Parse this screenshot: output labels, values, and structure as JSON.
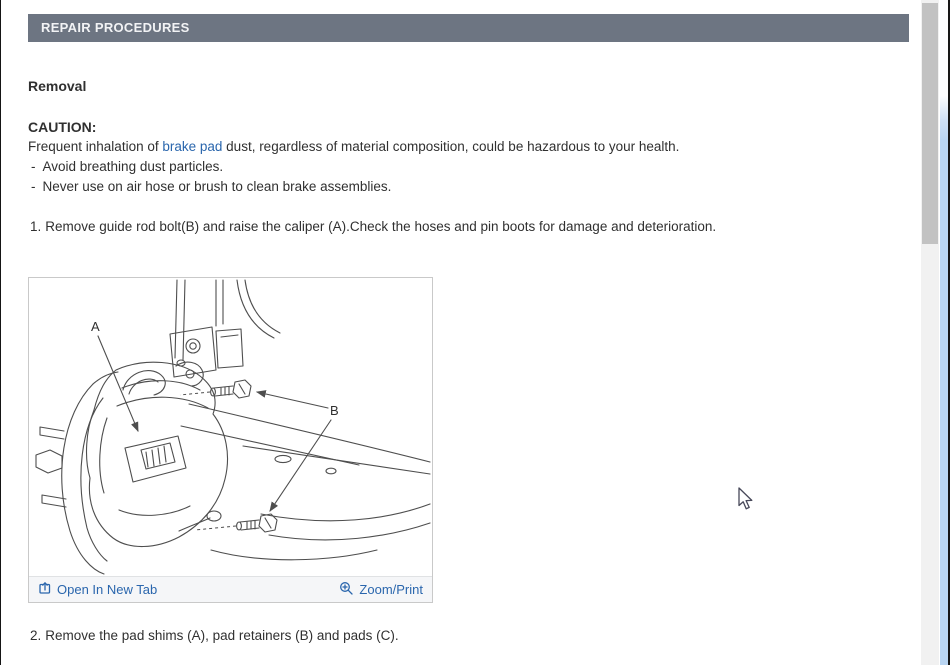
{
  "colors": {
    "header-bg": "#6d7582",
    "header-text": "#f2f3f5",
    "body-text": "#303030",
    "link": "#2a66ad",
    "figure-border": "#c9c9c9",
    "figure-footer-bg": "#f5f6f8",
    "scrollbar-track": "#f1f1f1",
    "scrollbar-thumb": "#c2c2c2",
    "outer-scroll-blue": "#b9d5f2",
    "diagram-stroke": "#4e4e4e"
  },
  "header": {
    "title": "REPAIR PROCEDURES"
  },
  "document": {
    "section_heading": "Removal",
    "caution_label": "CAUTION:",
    "caution_text_before_link": "Frequent inhalation of",
    "caution_link_text": "brake pad",
    "caution_text_after_link": "dust, regardless of material composition, could be hazardous to your health.",
    "bullet_marker": "-",
    "caution_bullets": [
      "Avoid breathing dust particles.",
      "Never use on air hose or brush to clean brake assemblies."
    ],
    "step1_number": "1.",
    "step1_text": "Remove guide rod bolt(B) and raise the caliper (A).Check the hoses and pin boots for damage and deterioration.",
    "step2_number": "2.",
    "step2_text": "Remove the pad shims (A), pad retainers (B) and pads (C)."
  },
  "figure": {
    "label_a": "A",
    "label_b": "B",
    "open_in_new_tab_label": "Open In New Tab",
    "zoom_print_label": "Zoom/Print",
    "icons": {
      "open_in_new_tab": "open-in-new-tab-icon",
      "zoom_print": "magnifier-plus-icon"
    }
  }
}
